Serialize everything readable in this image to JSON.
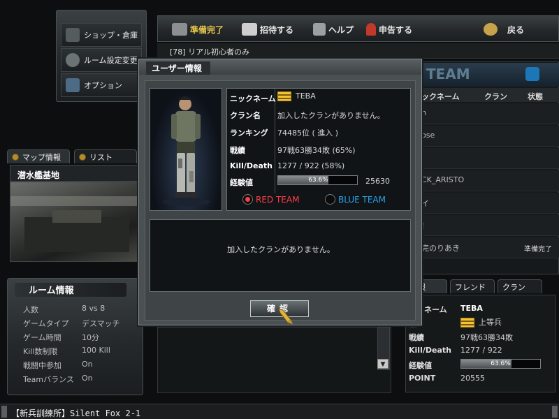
{
  "left_menu": {
    "items": [
      {
        "label": "ショップ・倉庫",
        "icon": "pistol-icon"
      },
      {
        "label": "ルーム設定変更",
        "icon": "gear-icon"
      },
      {
        "label": "オプション",
        "icon": "wrench-icon"
      }
    ]
  },
  "toolbar": {
    "ready_label": "準備完了",
    "invite_label": "招待する",
    "help_label": "ヘルプ",
    "report_label": "申告する",
    "back_label": "戻る"
  },
  "room": {
    "title": "[78] リアル初心者のみ"
  },
  "map_tabs": {
    "map_info": "マップ情報",
    "list": "リスト"
  },
  "map": {
    "name": "潜水艦基地"
  },
  "room_info": {
    "title": "ルーム情報",
    "rows": [
      {
        "label": "人数",
        "value": "8 vs 8"
      },
      {
        "label": "ゲームタイプ",
        "value": "デスマッチ"
      },
      {
        "label": "ゲーム時間",
        "value": "10分"
      },
      {
        "label": "Kill数制限",
        "value": "100 Kill"
      },
      {
        "label": "戦闘中参加",
        "value": "On"
      },
      {
        "label": "Teamバランス",
        "value": "On"
      }
    ]
  },
  "player_list": {
    "team_header": "TEAM",
    "col_name": "ックネーム",
    "col_clan": "クラン",
    "col_status": "状態",
    "rows": [
      {
        "name": "h",
        "status": ""
      },
      {
        "name": "ose",
        "status": ""
      },
      {
        "name": "",
        "status": ""
      },
      {
        "name": "CK_ARISTO",
        "status": ""
      },
      {
        "name": "イ",
        "status": ""
      },
      {
        "name": "！",
        "status": ""
      },
      {
        "name": "完のりあき",
        "status": "準備完了"
      }
    ]
  },
  "bottom_right": {
    "tabs": [
      "情報",
      "フレンド",
      "クラン"
    ],
    "nickname_label": "ックネーム",
    "nickname": "TEBA",
    "rank_label": "級",
    "rank": "上等兵",
    "record_label": "戦績",
    "record": "97戦63勝34敗",
    "kd_label": "Kill/Death",
    "kd": "1277 / 922",
    "exp_label": "経験値",
    "exp_pct_text": "63.6%",
    "exp_fraction": 0.636,
    "point_label": "POINT",
    "point": "20555"
  },
  "status_bar": {
    "text": "【新兵訓練所】Silent Fox 2-1"
  },
  "modal": {
    "title": "ユーザー情報",
    "labels": {
      "nickname": "ニックネーム",
      "clan": "クラン名",
      "ranking": "ランキング",
      "record": "戦績",
      "kd": "Kill/Death",
      "exp": "経験値"
    },
    "values": {
      "nickname": "TEBA",
      "clan": "加入したクランがありません。",
      "ranking": "74485位 ( 進入 )",
      "record": "97戦63勝34敗 (65%)",
      "kd": "1277 / 922 (58%)",
      "exp_pct_text": "63.6%",
      "exp_fraction": 0.636,
      "exp_value": "25630"
    },
    "team_red": "RED TEAM",
    "team_blue": "BLUE TEAM",
    "clan_message": "加入したクランがありません。",
    "confirm_label": "確認",
    "colors": {
      "red_team": "#ff3c4d",
      "blue_team": "#27a4f0",
      "gold": "#e7c64a"
    }
  }
}
